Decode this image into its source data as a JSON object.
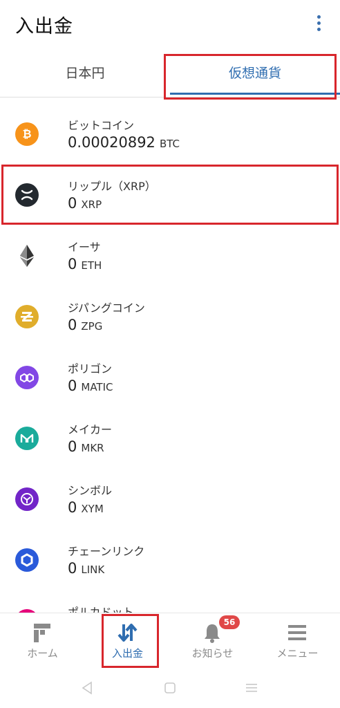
{
  "header": {
    "title": "入出金"
  },
  "tabs": [
    {
      "label": "日本円",
      "active": false
    },
    {
      "label": "仮想通貨",
      "active": true
    }
  ],
  "coins": [
    {
      "name": "ビットコイン",
      "amount": "0.00020892",
      "unit": "BTC",
      "icon": "bitcoin-icon",
      "color": "#f7931a"
    },
    {
      "name": "リップル（XRP）",
      "amount": "0",
      "unit": "XRP",
      "icon": "xrp-icon",
      "color": "#23292f"
    },
    {
      "name": "イーサ",
      "amount": "0",
      "unit": "ETH",
      "icon": "ethereum-icon",
      "color": "#3c3c3d"
    },
    {
      "name": "ジパングコイン",
      "amount": "0",
      "unit": "ZPG",
      "icon": "zipangcoin-icon",
      "color": "#e0ad2b"
    },
    {
      "name": "ポリゴン",
      "amount": "0",
      "unit": "MATIC",
      "icon": "polygon-icon",
      "color": "#8247e5"
    },
    {
      "name": "メイカー",
      "amount": "0",
      "unit": "MKR",
      "icon": "maker-icon",
      "color": "#1aab9b"
    },
    {
      "name": "シンボル",
      "amount": "0",
      "unit": "XYM",
      "icon": "symbol-icon",
      "color": "#7225c8"
    },
    {
      "name": "チェーンリンク",
      "amount": "0",
      "unit": "LINK",
      "icon": "chainlink-icon",
      "color": "#2a5ada"
    },
    {
      "name": "ポルカドット",
      "amount": "",
      "unit": "",
      "icon": "polkadot-icon",
      "color": "#e6007a"
    }
  ],
  "bottom_nav": [
    {
      "label": "ホーム",
      "icon": "home-icon",
      "active": false
    },
    {
      "label": "入出金",
      "icon": "transfer-icon",
      "active": true
    },
    {
      "label": "お知らせ",
      "icon": "bell-icon",
      "active": false
    },
    {
      "label": "メニュー",
      "icon": "menu-icon",
      "active": false
    }
  ],
  "notifications": {
    "badge": "56"
  },
  "colors": {
    "accent": "#2f6db0",
    "highlight": "#d8262c",
    "badge": "#e04848"
  }
}
